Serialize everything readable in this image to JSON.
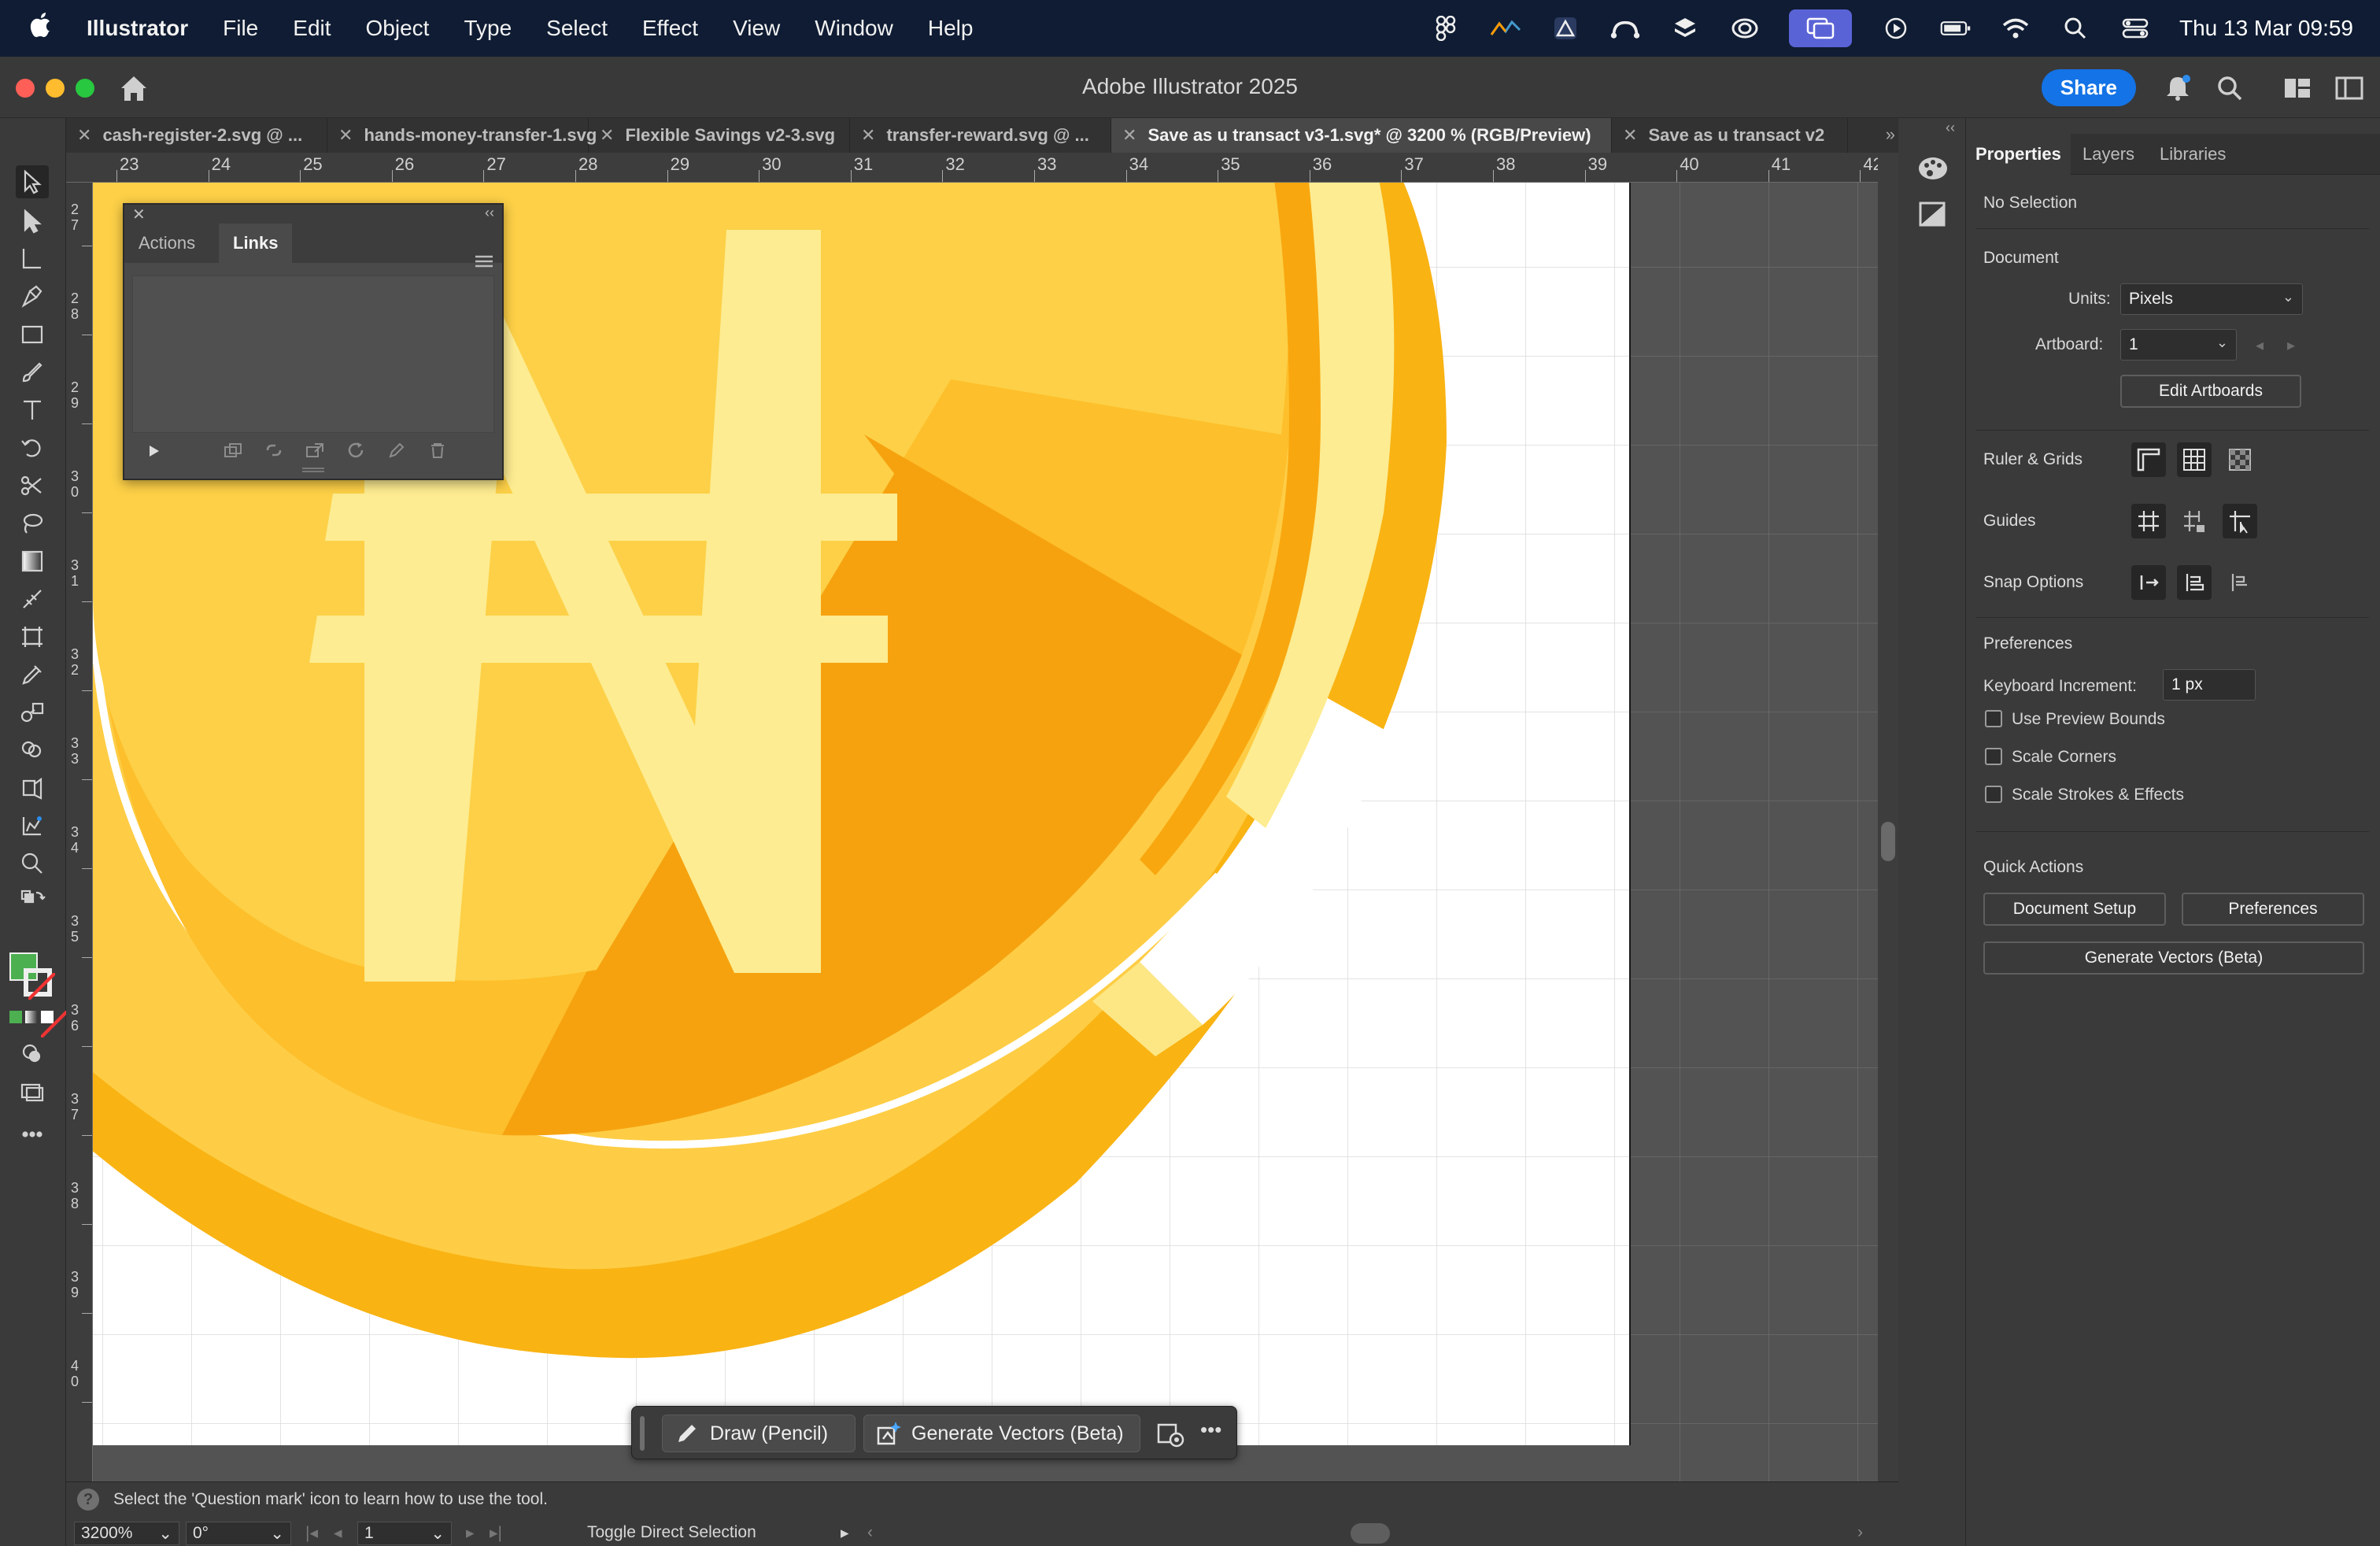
{
  "menubar": {
    "app_name": "Illustrator",
    "items": [
      "File",
      "Edit",
      "Object",
      "Type",
      "Select",
      "Effect",
      "View",
      "Window",
      "Help"
    ],
    "clock": "Thu 13 Mar  09:59",
    "tray_icons": [
      "figma-icon",
      "activity-icon",
      "triangle-app-icon",
      "cloud-sync-icon",
      "stack-icon",
      "creative-cloud-icon",
      "screen-mirror-icon",
      "play-icon",
      "battery-icon",
      "wifi-icon",
      "search-icon",
      "control-center-icon"
    ]
  },
  "window": {
    "title": "Adobe Illustrator 2025",
    "share_label": "Share"
  },
  "tabs": [
    {
      "label": "cash-register-2.svg @ ...",
      "active": false
    },
    {
      "label": "hands-money-transfer-1.svg",
      "active": false
    },
    {
      "label": "Flexible Savings v2-3.svg",
      "active": false
    },
    {
      "label": "transfer-reward.svg @ ...",
      "active": false
    },
    {
      "label": "Save as u transact v3-1.svg* @ 3200 % (RGB/Preview)",
      "active": true
    },
    {
      "label": "Save as u transact v2",
      "active": false
    }
  ],
  "rulers": {
    "horizontal": [
      "23",
      "24",
      "25",
      "26",
      "27",
      "28",
      "29",
      "30",
      "31",
      "32",
      "33",
      "34",
      "35",
      "36",
      "37",
      "38",
      "39",
      "40",
      "41",
      "42"
    ],
    "vertical": [
      "27",
      "28",
      "29",
      "30",
      "31",
      "32",
      "33",
      "34",
      "35",
      "36",
      "37",
      "38",
      "39",
      "40"
    ]
  },
  "links_panel": {
    "tabs": [
      "Actions",
      "Links"
    ],
    "active_tab": "Links"
  },
  "task_bar": {
    "draw_label": "Draw (Pencil)",
    "generate_label": "Generate Vectors (Beta)",
    "more_label": "•••"
  },
  "status_bar": {
    "hint": "Select the 'Question mark' icon to learn how to use the tool.",
    "zoom": "3200%",
    "rotation": "0°",
    "artboard_num": "1",
    "tool_name": "Toggle Direct Selection"
  },
  "properties": {
    "tabs": [
      "Properties",
      "Layers",
      "Libraries"
    ],
    "no_selection": "No Selection",
    "document_heading": "Document",
    "units_label": "Units:",
    "units_value": "Pixels",
    "artboard_label": "Artboard:",
    "artboard_value": "1",
    "edit_artboards": "Edit Artboards",
    "ruler_grids": "Ruler & Grids",
    "guides": "Guides",
    "snap_options": "Snap Options",
    "preferences_heading": "Preferences",
    "keyboard_increment_label": "Keyboard Increment:",
    "keyboard_increment_value": "1 px",
    "use_preview_bounds": "Use Preview Bounds",
    "scale_corners": "Scale Corners",
    "scale_strokes": "Scale Strokes & Effects",
    "quick_actions": "Quick Actions",
    "document_setup": "Document Setup",
    "preferences_btn": "Preferences",
    "generate_vectors": "Generate Vectors (Beta)"
  },
  "colors": {
    "accent": "#1473e6",
    "coin_dark": "#f6a20f",
    "coin_mid": "#fdd047",
    "coin_light": "#fdec91",
    "fill_swatch": "#4caf50"
  }
}
